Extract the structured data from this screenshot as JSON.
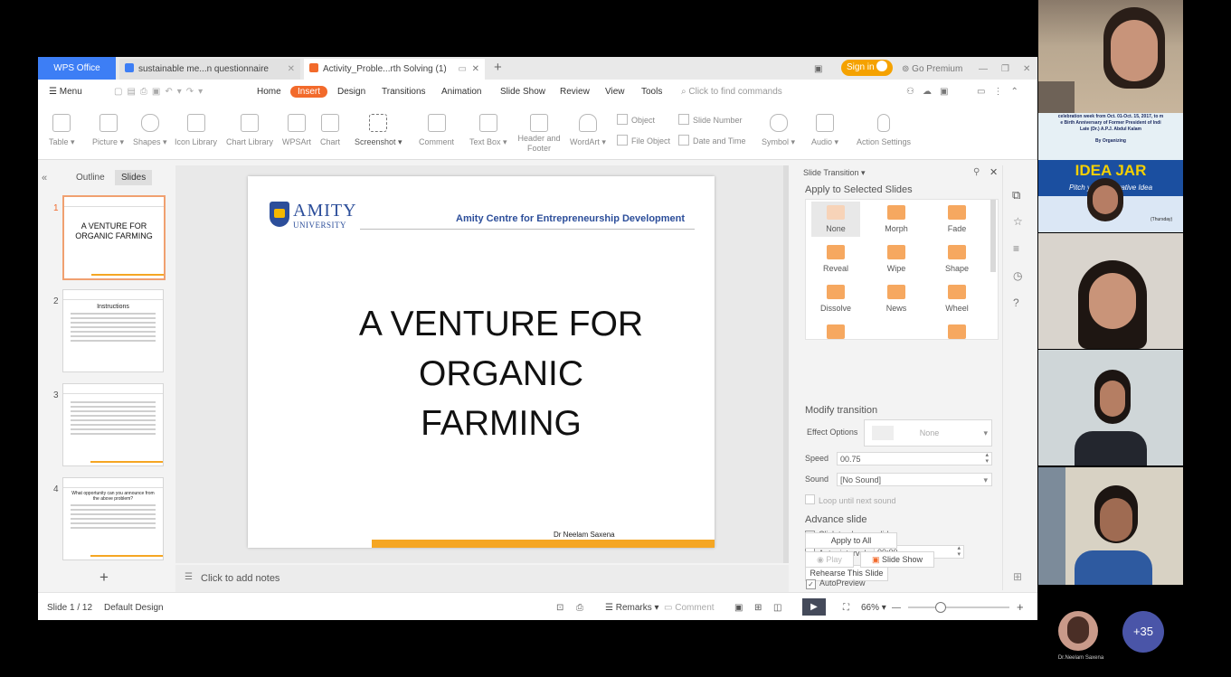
{
  "tabs": {
    "logo": "WPS Office",
    "doc1": "sustainable me...n questionnaire",
    "doc2": "Activity_Proble...rth Solving (1)",
    "sign_in": "Sign in",
    "go_premium": "Go Premium"
  },
  "menu": {
    "menu_label": "Menu",
    "items": [
      "Home",
      "Insert",
      "Design",
      "Transitions",
      "Animation",
      "Slide Show",
      "Review",
      "View",
      "Tools"
    ],
    "search_placeholder": "Click to find commands"
  },
  "ribbon": {
    "table": "Table",
    "picture": "Picture",
    "shapes": "Shapes",
    "icon_library": "Icon Library",
    "chart_library": "Chart Library",
    "wpsart": "WPSArt",
    "chart": "Chart",
    "screenshot": "Screenshot",
    "comment": "Comment",
    "text_box": "Text Box",
    "header_footer": "Header and Footer",
    "wordart": "WordArt",
    "object": "Object",
    "file_object": "File Object",
    "slide_number": "Slide Number",
    "date_time": "Date and Time",
    "symbol": "Symbol",
    "audio": "Audio",
    "action_settings": "Action Settings"
  },
  "left_panel": {
    "tab_outline": "Outline",
    "tab_slides": "Slides",
    "thumbs": [
      {
        "num": "1",
        "title": "A VENTURE FOR ORGANIC FARMING"
      },
      {
        "num": "2",
        "title": "Instructions"
      },
      {
        "num": "3",
        "title": ""
      },
      {
        "num": "4",
        "title": "What opportunity can you announce from the above problem?"
      }
    ],
    "add": "+"
  },
  "slide": {
    "logo_main": "AMITY",
    "logo_sub": "UNIVERSITY",
    "header": "Amity Centre for Entrepreneurship Development",
    "title_line1": "A VENTURE FOR",
    "title_line2": "ORGANIC",
    "title_line3": "FARMING",
    "footer_name": "Dr Neelam Saxena"
  },
  "notes": {
    "placeholder": "Click to add notes"
  },
  "transition_pane": {
    "header": "Slide Transition",
    "apply_selected": "Apply to Selected Slides",
    "transitions": [
      "None",
      "Morph",
      "Fade",
      "Reveal",
      "Wipe",
      "Shape",
      "Dissolve",
      "News",
      "Wheel"
    ],
    "modify": "Modify transition",
    "effect_options_label": "Effect Options",
    "effect_options_value": "None",
    "speed_label": "Speed",
    "speed_value": "00.75",
    "sound_label": "Sound",
    "sound_value": "[No Sound]",
    "loop_label": "Loop until next sound",
    "advance": "Advance slide",
    "on_click": "Click to change slides",
    "auto_label": "Auto, interval",
    "auto_value": "00:00",
    "rehearse": "Rehearse This Slide",
    "apply_all": "Apply to All",
    "play": "Play",
    "slide_show": "Slide Show",
    "autopreview": "AutoPreview"
  },
  "status": {
    "slide_counter": "Slide 1 / 12",
    "design": "Default Design",
    "remarks": "Remarks",
    "comment": "Comment",
    "zoom": "66%"
  },
  "participants": {
    "banner_line1": "celebration week from Oct. 01-Oct. 15, 2017, to m",
    "banner_line2": "e Birth Anniversary of Former President of Indi",
    "banner_line3": "Late (Dr.) A.P.J. Abdul Kalam",
    "banner_line4": "By Organizing",
    "idea_jar": "IDEA JAR",
    "idea_sub": "Pitch your Innovative Idea",
    "idea_sub2": "(Thursday)",
    "self_name": "Dr.Neelam Saxena",
    "more_count": "+35"
  }
}
